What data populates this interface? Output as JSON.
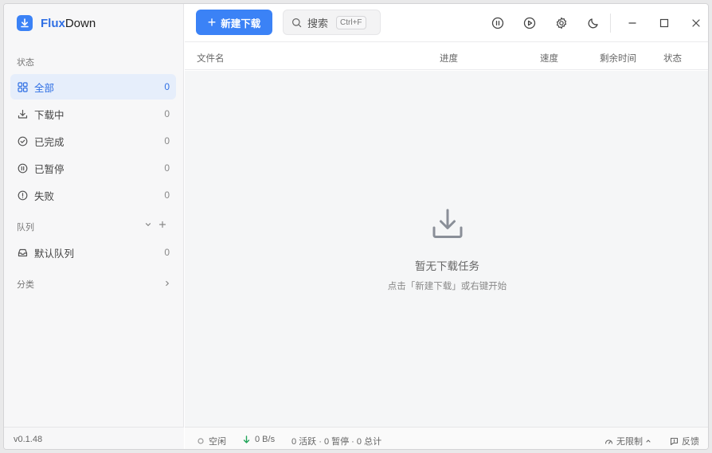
{
  "app": {
    "name_part1": "Flux",
    "name_part2": "Down",
    "version": "v0.1.48"
  },
  "sidebar": {
    "status_label": "状态",
    "items": [
      {
        "label": "全部",
        "count": "0",
        "icon": "grid-icon"
      },
      {
        "label": "下载中",
        "count": "0",
        "icon": "download-icon"
      },
      {
        "label": "已完成",
        "count": "0",
        "icon": "check-circle-icon"
      },
      {
        "label": "已暂停",
        "count": "0",
        "icon": "pause-circle-icon"
      },
      {
        "label": "失败",
        "count": "0",
        "icon": "alert-circle-icon"
      }
    ],
    "queue_label": "队列",
    "queues": [
      {
        "label": "默认队列",
        "count": "0",
        "icon": "inbox-icon"
      }
    ],
    "category_label": "分类"
  },
  "toolbar": {
    "new_download": "新建下载",
    "search_placeholder": "搜索",
    "search_shortcut": "Ctrl+F"
  },
  "table": {
    "columns": [
      "文件名",
      "进度",
      "速度",
      "剩余时间",
      "状态"
    ]
  },
  "empty": {
    "title": "暂无下载任务",
    "subtitle": "点击「新建下载」或右键开始"
  },
  "statusbar": {
    "state": "空闲",
    "speed": "0 B/s",
    "summary": "0 活跃 · 0 暂停 · 0 总计",
    "limit": "无限制",
    "feedback": "反馈"
  },
  "colors": {
    "accent": "#3b82f6",
    "active_bg": "#e6eefb"
  }
}
